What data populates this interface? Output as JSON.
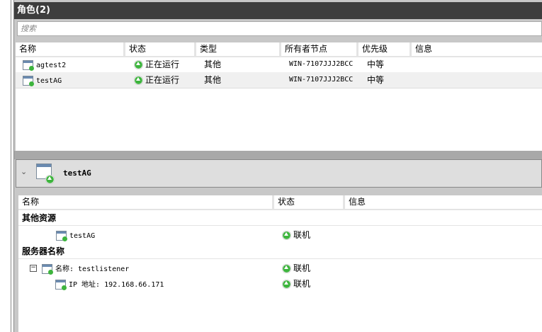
{
  "roles": {
    "title": "角色(2)",
    "search_placeholder": "搜索",
    "columns": [
      "名称",
      "状态",
      "类型",
      "所有者节点",
      "优先级",
      "信息"
    ],
    "rows": [
      {
        "name": "agtest2",
        "status": "正在运行",
        "type": "其他",
        "owner": "WIN-7107JJJ2BCC",
        "priority": "中等",
        "info": ""
      },
      {
        "name": "testAG",
        "status": "正在运行",
        "type": "其他",
        "owner": "WIN-7107JJJ2BCC",
        "priority": "中等",
        "info": ""
      }
    ]
  },
  "detail": {
    "title": "testAG",
    "columns": [
      "名称",
      "状态",
      "信息"
    ],
    "sections": [
      {
        "label": "其他资源",
        "items": [
          {
            "name": "testAG",
            "status": "联机"
          }
        ]
      },
      {
        "label": "服务器名称",
        "items": [
          {
            "name": "名称: testlistener",
            "status": "联机"
          },
          {
            "name": "IP 地址: 192.168.66.171",
            "status": "联机"
          }
        ]
      }
    ]
  },
  "colors": {
    "title_bar": "#3e3e3e",
    "online": "#3db43d"
  }
}
